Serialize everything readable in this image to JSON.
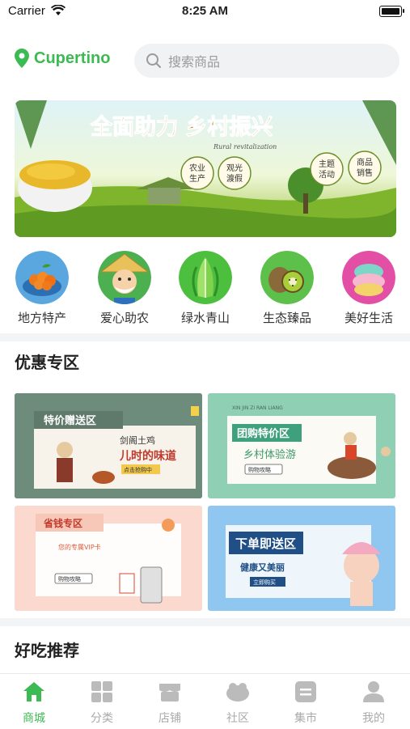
{
  "status_bar": {
    "carrier": "Carrier",
    "time": "8:25 AM"
  },
  "header": {
    "location": "Cupertino",
    "search_placeholder": "搜索商品"
  },
  "banner": {
    "title": "全面助力 乡村振兴",
    "subtitle": "Rural revitalization",
    "tags": [
      "农业生产",
      "观光渡假",
      "主题活动",
      "商品销售"
    ]
  },
  "categories": [
    {
      "label": "地方特产",
      "icon": "orange-fruit-icon"
    },
    {
      "label": "爱心助农",
      "icon": "farmer-icon"
    },
    {
      "label": "绿水青山",
      "icon": "green-vegetable-icon"
    },
    {
      "label": "生态臻品",
      "icon": "kiwi-icon"
    },
    {
      "label": "美好生活",
      "icon": "macaron-icon"
    }
  ],
  "sections": {
    "discount": "优惠专区",
    "recommend": "好吃推荐"
  },
  "promos": [
    {
      "title": "特价赠送区",
      "line1": "剑阁土鸡",
      "line2": "儿时的味道",
      "badge": "点击抢购中"
    },
    {
      "title": "团购特价区",
      "top": "XIN JIN ZI RAN LIANG",
      "line1": "乡村体验游",
      "button": "购物攻略"
    },
    {
      "title": "省钱专区",
      "line1": "您的专属VIP卡",
      "button": "购物攻略"
    },
    {
      "title": "下单即送区",
      "line1": "健康又美丽",
      "button": "立即购买"
    }
  ],
  "tabs": [
    {
      "label": "商城",
      "icon": "home-icon",
      "active": true
    },
    {
      "label": "分类",
      "icon": "grid-icon",
      "active": false
    },
    {
      "label": "店铺",
      "icon": "store-icon",
      "active": false
    },
    {
      "label": "社区",
      "icon": "community-icon",
      "active": false
    },
    {
      "label": "集市",
      "icon": "market-icon",
      "active": false
    },
    {
      "label": "我的",
      "icon": "user-icon",
      "active": false
    }
  ],
  "colors": {
    "accent": "#3cba54",
    "inactive": "#aaaaaa"
  }
}
